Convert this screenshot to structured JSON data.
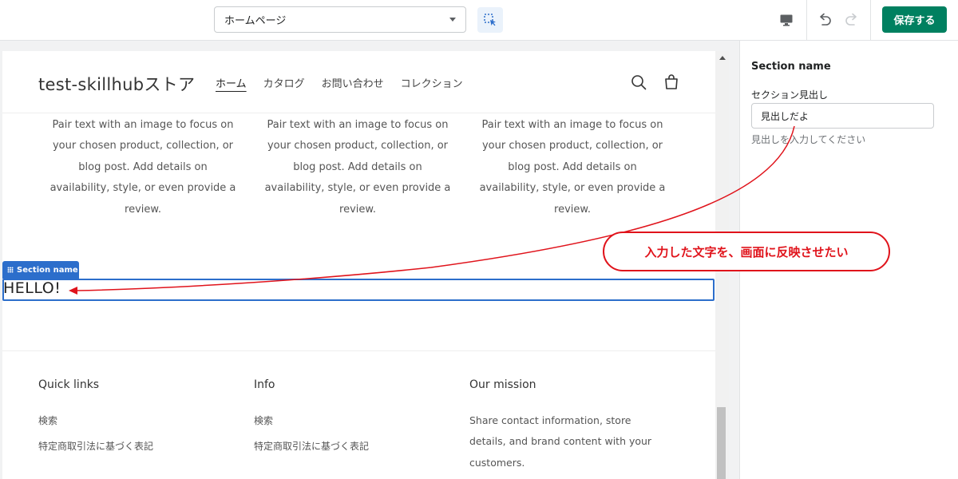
{
  "toolbar": {
    "page_select_value": "ホームページ",
    "save_label": "保存する"
  },
  "store": {
    "logo": "test-skillhubストア",
    "nav": [
      "ホーム",
      "カタログ",
      "お問い合わせ",
      "コレクション"
    ]
  },
  "columns": [
    "Pair text with an image to focus on your chosen product, collection, or blog post. Add details on availability, style, or even provide a review.",
    "Pair text with an image to focus on your chosen product, collection, or blog post. Add details on availability, style, or even provide a review.",
    "Pair text with an image to focus on your chosen product, collection, or blog post. Add details on availability, style, or even provide a review."
  ],
  "section": {
    "tag_label": "Section name",
    "heading": "HELLO!"
  },
  "footer": {
    "quick_links_title": "Quick links",
    "quick_links": [
      "検索",
      "特定商取引法に基づく表記"
    ],
    "info_title": "Info",
    "info_links": [
      "検索",
      "特定商取引法に基づく表記"
    ],
    "mission_title": "Our mission",
    "mission_text": "Share contact information, store details, and brand content with your customers."
  },
  "panel": {
    "title": "Section name",
    "field_label": "セクション見出し",
    "field_value": "見出しだよ",
    "field_help": "見出しを入力してください"
  },
  "annotation": {
    "callout_text": "入力した文字を、画面に反映させたい",
    "color": "#e0131b"
  },
  "colors": {
    "accent": "#2c6ecb",
    "primary_button": "#008060"
  }
}
